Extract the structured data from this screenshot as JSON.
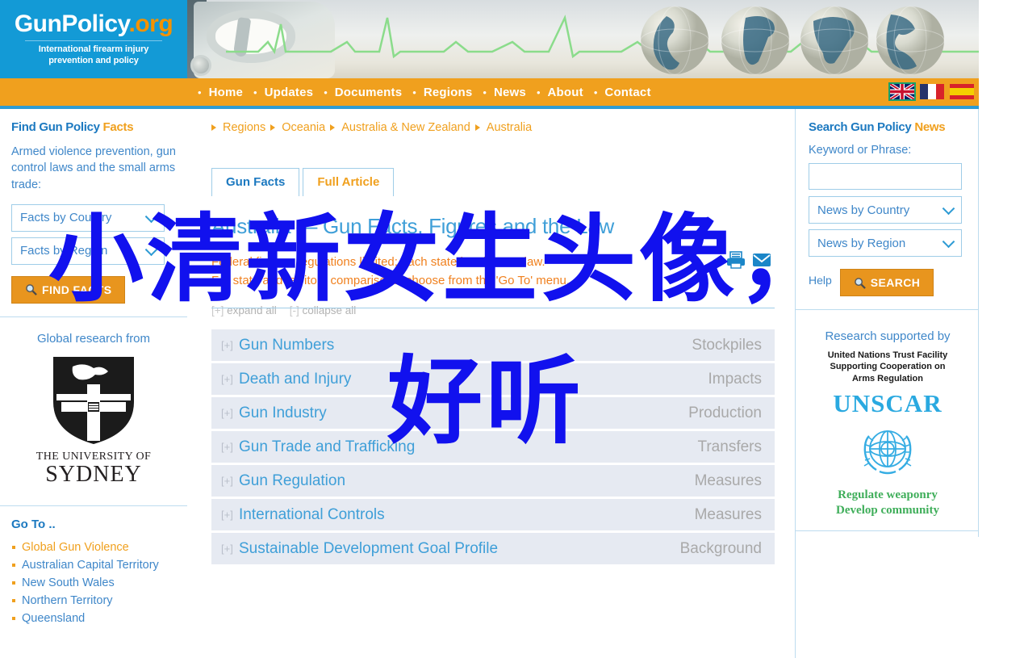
{
  "site": {
    "logo_main": "GunPolicy",
    "logo_dot": ".org",
    "logo_tagline_1": "International firearm injury",
    "logo_tagline_2": "prevention and policy"
  },
  "nav": {
    "items": [
      {
        "label": "Home",
        "name": "nav-home"
      },
      {
        "label": "Updates",
        "name": "nav-updates"
      },
      {
        "label": "Documents",
        "name": "nav-documents"
      },
      {
        "label": "Regions",
        "name": "nav-regions"
      },
      {
        "label": "News",
        "name": "nav-news"
      },
      {
        "label": "About",
        "name": "nav-about"
      },
      {
        "label": "Contact",
        "name": "nav-contact"
      }
    ],
    "flags": [
      {
        "name": "flag-english",
        "title": "English",
        "active": true
      },
      {
        "name": "flag-french",
        "title": "Français",
        "active": false
      },
      {
        "name": "flag-spanish",
        "title": "Español",
        "active": false
      }
    ]
  },
  "left_sidebar": {
    "find_facts": {
      "title_main": "Find Gun Policy ",
      "title_accent": "Facts",
      "lead": "Armed violence prevention, gun control laws and the small arms trade:",
      "select_country": "Facts by Country",
      "select_region": "Facts by Region",
      "button": "FIND FACTS"
    },
    "research": {
      "heading": "Global research from",
      "university_line_1": "THE UNIVERSITY OF",
      "university_line_2": "SYDNEY"
    },
    "go_to": {
      "title": "Go To ..",
      "items": [
        {
          "label": "Global Gun Violence",
          "hot": true
        },
        {
          "label": "Australian Capital Territory",
          "hot": false
        },
        {
          "label": "New South Wales",
          "hot": false
        },
        {
          "label": "Northern Territory",
          "hot": false
        },
        {
          "label": "Queensland",
          "hot": false
        }
      ]
    }
  },
  "main": {
    "breadcrumb": [
      "Regions",
      "Oceania",
      "Australia & New Zealand",
      "Australia"
    ],
    "tabs": [
      {
        "label": "Gun Facts",
        "active": true
      },
      {
        "label": "Full Article",
        "active": false
      }
    ],
    "title": "Australia — Gun Facts, Figures and the Law",
    "intro_line_1": "Federal firearm regulations limited; each state has its own law.",
    "intro_line_2": "For state and territory comparisons, choose from the 'Go To' menu.",
    "icons": [
      {
        "name": "print-icon",
        "title": "Print"
      },
      {
        "name": "email-icon",
        "title": "Email"
      }
    ],
    "expand_all": "expand all",
    "collapse_all": "collapse all",
    "expand_marker": "[+]",
    "collapse_marker": "[-]",
    "accordion": [
      {
        "label": "Gun Numbers",
        "meta": "Stockpiles"
      },
      {
        "label": "Death and Injury",
        "meta": "Impacts"
      },
      {
        "label": "Gun Industry",
        "meta": "Production"
      },
      {
        "label": "Gun Trade and Trafficking",
        "meta": "Transfers"
      },
      {
        "label": "Gun Regulation",
        "meta": "Measures"
      },
      {
        "label": "International Controls",
        "meta": "Measures"
      },
      {
        "label": "Sustainable Development Goal Profile",
        "meta": "Background"
      }
    ]
  },
  "right_sidebar": {
    "search": {
      "title_main": "Search Gun Policy ",
      "title_accent": "News",
      "keyword_label": "Keyword or Phrase:",
      "keyword_value": "",
      "keyword_placeholder": "",
      "select_country": "News by Country",
      "select_region": "News by Region",
      "help": "Help",
      "button": "SEARCH"
    },
    "supporter": {
      "heading": "Research supported by",
      "caption_1": "United Nations Trust Facility",
      "caption_2": "Supporting Cooperation on",
      "caption_3": "Arms Regulation",
      "wordmark": "UNSCAR",
      "tagline_1": "Regulate weaponry",
      "tagline_2": "Develop community"
    }
  },
  "overlay": {
    "line_1": "小清新女生头像，",
    "line_2": "好听"
  },
  "colors": {
    "brand_blue": "#139ad6",
    "brand_orange": "#f0a01e",
    "link_blue": "#3f87c9",
    "title_blue": "#3f9fd8",
    "accordion_bg": "#e6eaf2",
    "overlay_blue": "#1111ee"
  }
}
